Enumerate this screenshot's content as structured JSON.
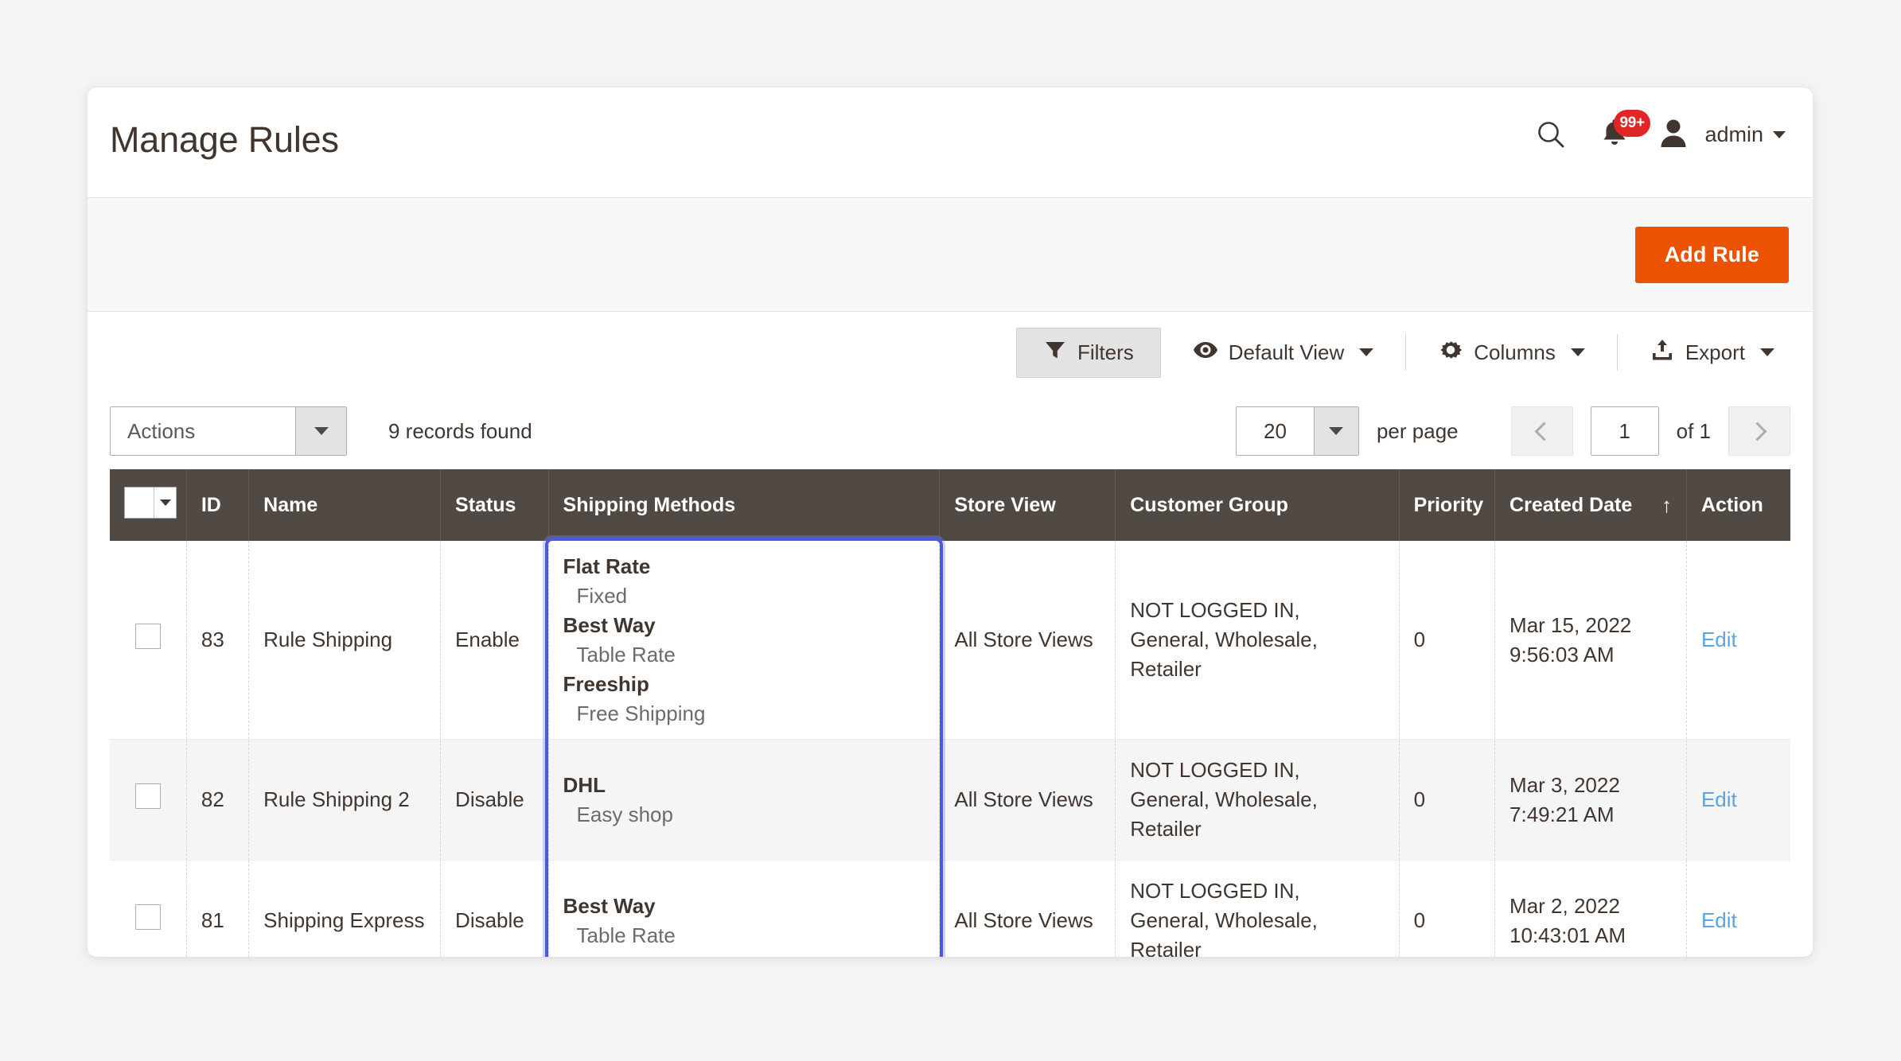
{
  "header": {
    "title": "Manage Rules",
    "search_icon": "search-icon",
    "notifications_icon": "bell-icon",
    "notifications_count": "99+",
    "avatar_icon": "user-avatar-icon",
    "admin_label": "admin"
  },
  "page_actions": {
    "add_rule_label": "Add Rule"
  },
  "toolbar": {
    "filters_label": "Filters",
    "filters_icon": "funnel-icon",
    "view_label": "Default View",
    "view_icon": "eye-icon",
    "columns_label": "Columns",
    "columns_icon": "gear-icon",
    "export_label": "Export",
    "export_icon": "upload-icon"
  },
  "controls": {
    "actions_label": "Actions",
    "records_found": "9 records found",
    "per_page_value": "20",
    "per_page_label": "per page",
    "page_value": "1",
    "page_of": "of 1",
    "prev_icon": "chevron-left-icon",
    "next_icon": "chevron-right-icon"
  },
  "grid": {
    "columns": [
      {
        "key": "select",
        "label": ""
      },
      {
        "key": "id",
        "label": "ID"
      },
      {
        "key": "name",
        "label": "Name"
      },
      {
        "key": "status",
        "label": "Status"
      },
      {
        "key": "shipping_methods",
        "label": "Shipping Methods"
      },
      {
        "key": "store_view",
        "label": "Store View"
      },
      {
        "key": "customer_group",
        "label": "Customer Group"
      },
      {
        "key": "priority",
        "label": "Priority"
      },
      {
        "key": "created_date",
        "label": "Created Date"
      },
      {
        "key": "action",
        "label": "Action"
      }
    ],
    "sort_column": "Created Date",
    "sort_arrow": "↑",
    "action_label": "Edit",
    "rows": [
      {
        "id": "83",
        "name": "Rule Shipping",
        "status": "Enable",
        "shipping_methods": [
          {
            "carrier": "Flat Rate",
            "method": "Fixed"
          },
          {
            "carrier": "Best Way",
            "method": "Table Rate"
          },
          {
            "carrier": "Freeship",
            "method": "Free Shipping"
          }
        ],
        "store_view": "All Store Views",
        "customer_group": "NOT LOGGED IN, General, Wholesale, Retailer",
        "priority": "0",
        "created_date_day": "Mar 15, 2022",
        "created_date_time": "9:56:03 AM",
        "action": "Edit"
      },
      {
        "id": "82",
        "name": "Rule Shipping 2",
        "status": "Disable",
        "shipping_methods": [
          {
            "carrier": "DHL",
            "method": "Easy shop"
          }
        ],
        "store_view": "All Store Views",
        "customer_group": "NOT LOGGED IN, General, Wholesale, Retailer",
        "priority": "0",
        "created_date_day": "Mar 3, 2022",
        "created_date_time": "7:49:21 AM",
        "action": "Edit"
      },
      {
        "id": "81",
        "name": "Shipping Express",
        "status": "Disable",
        "shipping_methods": [
          {
            "carrier": "Best Way",
            "method": "Table Rate"
          }
        ],
        "store_view": "All Store Views",
        "customer_group": "NOT LOGGED IN, General, Wholesale, Retailer",
        "priority": "0",
        "created_date_day": "Mar 2, 2022",
        "created_date_time": "10:43:01 AM",
        "action": "Edit"
      }
    ]
  },
  "colors": {
    "accent": "#eb5202",
    "header_bar": "#514943",
    "link": "#5aa4e0",
    "badge": "#e22626",
    "highlight": "#4a5ae0"
  }
}
